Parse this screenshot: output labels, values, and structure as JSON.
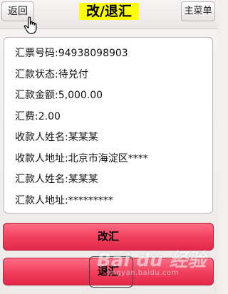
{
  "header": {
    "back_label": "返回",
    "title": "改/退汇",
    "menu_label": "主菜单"
  },
  "details": [
    {
      "label": "汇票号码:",
      "value": "94938098903"
    },
    {
      "label": "汇款状态:",
      "value": "待兑付"
    },
    {
      "label": "汇款金额:",
      "value": "5,000.00"
    },
    {
      "label": "汇费:",
      "value": "2.00"
    },
    {
      "label": "收款人姓名:",
      "value": "某某某"
    },
    {
      "label": "收款人地址:",
      "value": "北京市海淀区****"
    },
    {
      "label": "汇款人姓名:",
      "value": "某某某"
    },
    {
      "label": "汇款人地址:",
      "value": "*********"
    }
  ],
  "actions": {
    "modify_label": "改汇",
    "return_label": "退汇"
  },
  "watermark": {
    "logo": "Bai du 经验",
    "url": "jingyan.baidu.com"
  },
  "colors": {
    "title_bg": "#ffff0a",
    "button_red": "#f24260"
  }
}
